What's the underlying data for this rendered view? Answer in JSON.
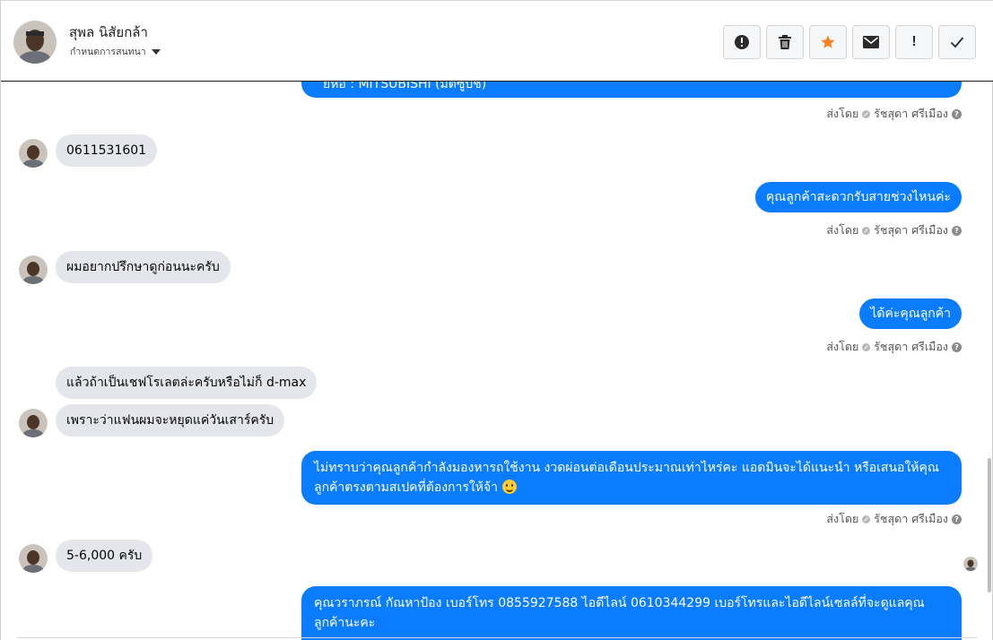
{
  "header": {
    "name": "สุพล นิสัยกล้า",
    "subtitle": "กำหนดการสนทนา"
  },
  "toolbar": {
    "buttons": [
      {
        "icon": "alert-circle-icon"
      },
      {
        "icon": "trash-icon"
      },
      {
        "icon": "star-icon",
        "color": "#f5821f"
      },
      {
        "icon": "envelope-icon"
      },
      {
        "icon": "exclamation-icon",
        "label": "!"
      },
      {
        "icon": "check-icon"
      }
    ]
  },
  "sent_by": {
    "prefix": "ส่งโดย",
    "agent": "รัชสุดา ศรีเมือง"
  },
  "messages": {
    "m0": "ยี่ห้อ : MITSUBISHI (มิตซูบิชิ)",
    "m1": "0611531601",
    "m2": "คุณลูกค้าสะดวกรับสายช่วงไหนค่ะ",
    "m3": "ผมอยากปรึกษาดูก่อนนะครับ",
    "m4": "ได้ค่ะคุณลูกค้า",
    "m5": "แล้วถ้าเป็นเชฟโรเลตล่ะครับหรือไม่ก็ d-max",
    "m6": "เพราะว่าแฟนผมจะหยุดแค่วันเสาร์ครับ",
    "m7": "ไม่ทราบว่าคุณลูกค้ากำลังมองหารถใช้งาน งวดผ่อนต่อเดือนประมาณเท่าไหร่คะ แอดมินจะได้แนะนำ หรือเสนอให้คุณลูกค้าตรงตามสเปคที่ต้องการให้จ้า",
    "m8": "5-6,000 ครับ",
    "m9": "คุณวราภรณ์ กัณหาป้อง  เบอร์โทร 0855927588  ไอดีไลน์ 0610344299   เบอร์โทรและไอดีไลน์เซลล์ที่จะดูแลคุณลูกค้านะคะ"
  },
  "colors": {
    "outgoing": "#0a7cff",
    "incoming": "#e4e6eb"
  }
}
